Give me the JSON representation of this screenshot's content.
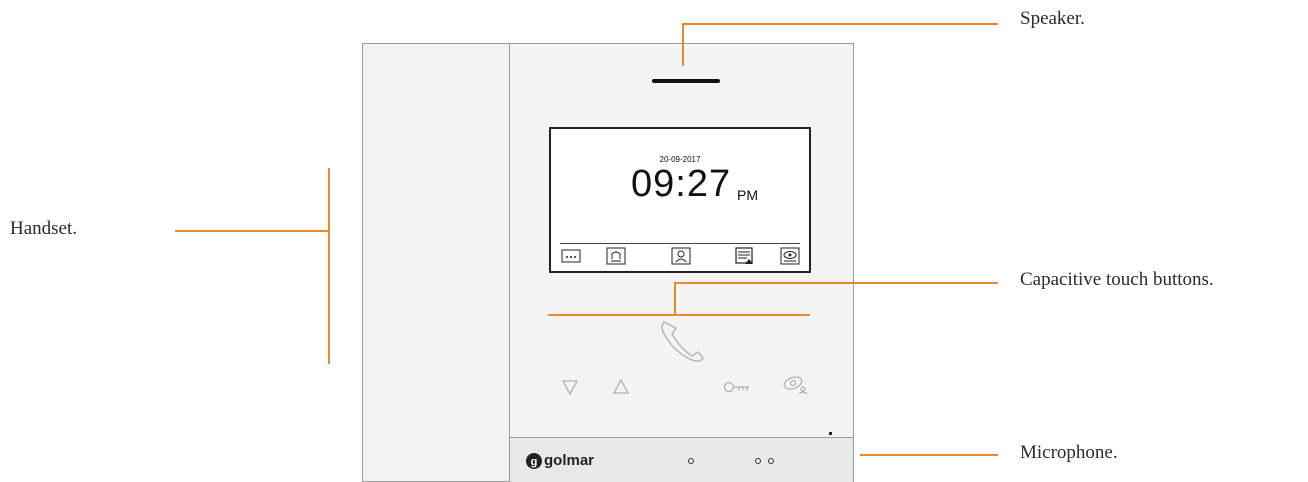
{
  "labels": {
    "speaker": "Speaker.",
    "handset": "Handset.",
    "touch_buttons": "Capacitive touch buttons.",
    "microphone": "Microphone."
  },
  "screen": {
    "date": "20-09-2017",
    "time": "09:27",
    "ampm": "PM",
    "icons": [
      "menu-dots-icon",
      "intercom-call-icon",
      "concierge-icon",
      "calendar-alert-icon",
      "camera-eye-icon"
    ]
  },
  "touch_buttons": [
    "phone-handset-icon",
    "arrow-down-icon",
    "arrow-up-icon",
    "key-icon",
    "camera-view-icon"
  ],
  "brand": {
    "logo": "golmar"
  },
  "colors": {
    "leader_line": "#e8892a",
    "device_body": "#f4f4f4",
    "device_border": "#9a9a9a"
  }
}
